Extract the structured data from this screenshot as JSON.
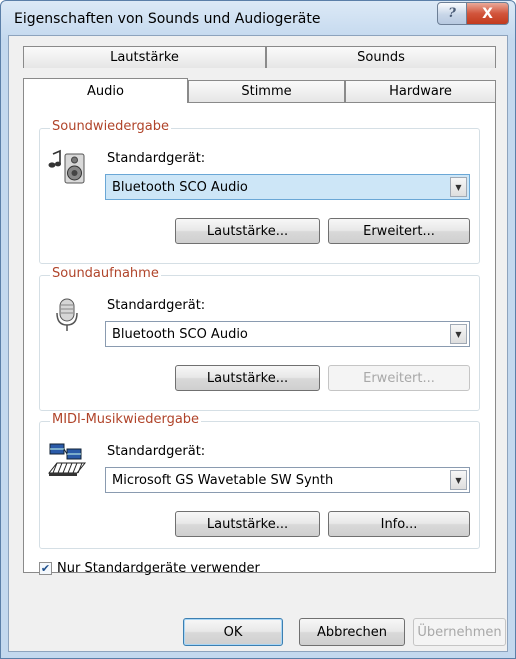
{
  "window": {
    "title": "Eigenschaften von Sounds und Audiogeräte"
  },
  "titlebar": {
    "help_glyph": "?",
    "close_glyph": "X"
  },
  "tabs": {
    "row1": [
      "Lautstärke",
      "Sounds"
    ],
    "row2": [
      "Audio",
      "Stimme",
      "Hardware"
    ],
    "active": "Audio"
  },
  "groups": {
    "playback": {
      "title": "Soundwiedergabe",
      "label": "Standardgerät:",
      "selected_device": "Bluetooth SCO Audio",
      "volume_button": "Lautstärke...",
      "advanced_button": "Erweitert..."
    },
    "recording": {
      "title": "Soundaufnahme",
      "label": "Standardgerät:",
      "selected_device": "Bluetooth SCO Audio",
      "volume_button": "Lautstärke...",
      "advanced_button": "Erweitert...",
      "advanced_enabled": false
    },
    "midi": {
      "title": "MIDI-Musikwiedergabe",
      "label": "Standardgerät:",
      "selected_device": "Microsoft GS Wavetable SW Synth",
      "volume_button": "Lautstärke...",
      "info_button": "Info..."
    }
  },
  "checkbox": {
    "label": "Nur Standardgeräte verwender",
    "checked": true,
    "check_glyph": "✔"
  },
  "dialog_buttons": {
    "ok": "OK",
    "cancel": "Abbrechen",
    "apply": "Übernehmen",
    "apply_enabled": false
  },
  "icons": {
    "speaker": "speaker-icon",
    "microphone": "microphone-icon",
    "midi": "midi-keyboard-icon",
    "dropdown": "chevron-down-icon"
  },
  "colors": {
    "group_title": "#b0442a",
    "selection": "#cde6f7",
    "close_button": "#c23a1d"
  }
}
